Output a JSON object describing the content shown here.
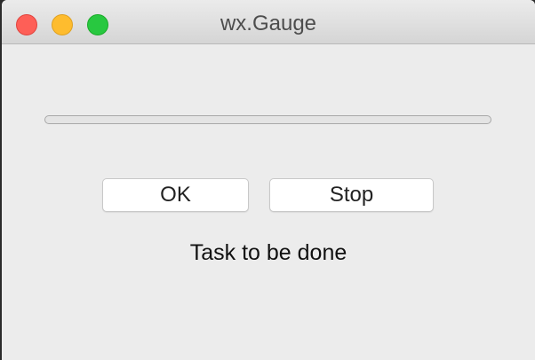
{
  "window": {
    "title": "wx.Gauge"
  },
  "gauge": {
    "progress": 0
  },
  "buttons": {
    "ok_label": "OK",
    "stop_label": "Stop"
  },
  "status": {
    "text": "Task to be done"
  },
  "colors": {
    "close": "#fe5f57",
    "minimize": "#febc2e",
    "maximize": "#28c840",
    "window_bg": "#ececec"
  },
  "icons": {
    "close": "close-icon",
    "minimize": "minimize-icon",
    "maximize": "maximize-icon"
  }
}
